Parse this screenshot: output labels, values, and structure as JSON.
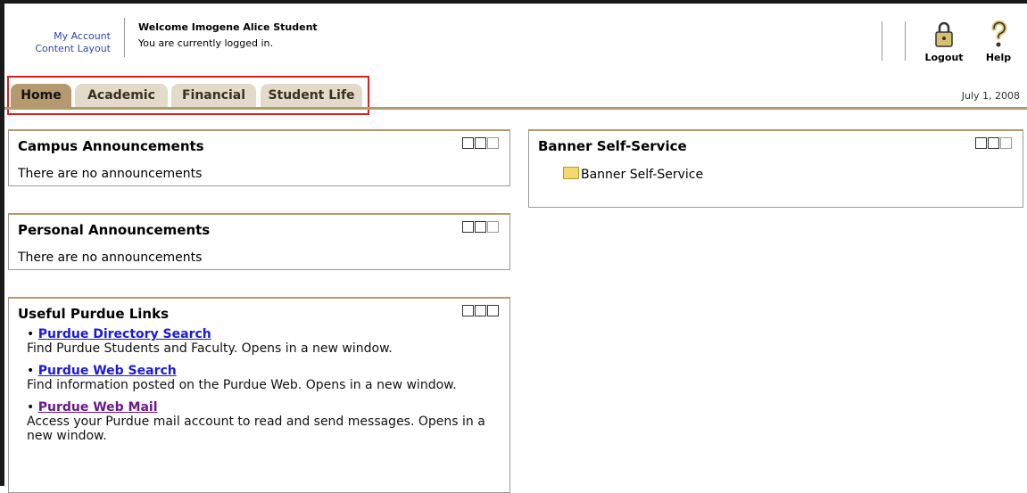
{
  "header": {
    "account_links": [
      "My Account",
      "Content Layout"
    ],
    "welcome": "Welcome Imogene Alice Student",
    "status": "You are currently logged in.",
    "logout_label": "Logout",
    "help_label": "Help"
  },
  "tabs": [
    {
      "label": "Home",
      "active": true
    },
    {
      "label": "Academic",
      "active": false
    },
    {
      "label": "Financial",
      "active": false
    },
    {
      "label": "Student Life",
      "active": false
    }
  ],
  "date": "July 1, 2008",
  "portlets": {
    "campus": {
      "title": "Campus Announcements",
      "body": "There are no announcements"
    },
    "personal": {
      "title": "Personal Announcements",
      "body": "There are no announcements"
    },
    "links": {
      "title": "Useful Purdue Links",
      "items": [
        {
          "title": "Purdue Directory Search",
          "desc": "Find Purdue Students and Faculty. Opens in a new window."
        },
        {
          "title": "Purdue Web Search",
          "desc": "Find information posted on the Purdue Web. Opens in a new window."
        },
        {
          "title": "Purdue Web Mail",
          "desc": "Access your Purdue mail account to read and send messages. Opens in a new window."
        }
      ]
    },
    "banner": {
      "title": "Banner Self-Service",
      "folder_label": "Banner Self-Service"
    }
  },
  "colors": {
    "tab_active": "#b59a70",
    "tab_inactive": "#e3dbc9",
    "highlight": "#e11d1d",
    "link": "#1a1adb"
  }
}
